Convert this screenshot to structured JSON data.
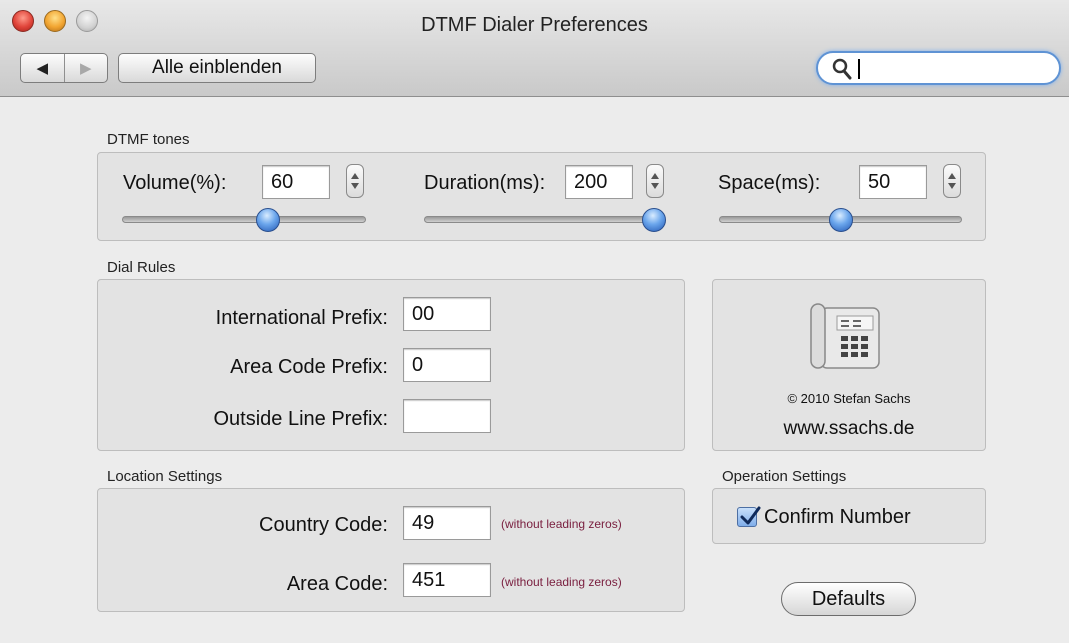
{
  "window": {
    "title": "DTMF Dialer Preferences"
  },
  "toolbar": {
    "back_glyph": "◀",
    "forward_glyph": "▶",
    "show_all_label": "Alle einblenden",
    "search_value": ""
  },
  "dtmf_tones": {
    "group_label": "DTMF tones",
    "volume": {
      "label": "Volume(%):",
      "value": "60",
      "slider_fraction": 0.6
    },
    "duration": {
      "label": "Duration(ms):",
      "value": "200",
      "slider_fraction": 1.0
    },
    "space": {
      "label": "Space(ms):",
      "value": "50",
      "slider_fraction": 0.5
    }
  },
  "dial_rules": {
    "group_label": "Dial Rules",
    "international_prefix": {
      "label": "International Prefix:",
      "value": "00"
    },
    "area_code_prefix": {
      "label": "Area Code Prefix:",
      "value": "0"
    },
    "outside_line_prefix": {
      "label": "Outside Line Prefix:",
      "value": ""
    }
  },
  "about": {
    "icon": "telephone-icon",
    "copyright": "© 2010 Stefan Sachs",
    "website": "www.ssachs.de"
  },
  "location_settings": {
    "group_label": "Location Settings",
    "country_code": {
      "label": "Country Code:",
      "value": "49",
      "hint": "(without leading zeros)"
    },
    "area_code": {
      "label": "Area Code:",
      "value": "451",
      "hint": "(without leading zeros)"
    }
  },
  "operation_settings": {
    "group_label": "Operation Settings",
    "confirm_number": {
      "label": "Confirm Number",
      "checked": true
    }
  },
  "defaults_button": {
    "label": "Defaults"
  },
  "colors": {
    "accent": "#5f93d4",
    "hint_text": "#7a2040",
    "slider_knob": "#3b78d4"
  }
}
